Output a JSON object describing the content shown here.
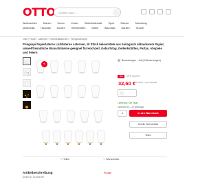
{
  "header": {
    "logo": "OTTO",
    "search_placeholder": "Suchen nach ..."
  },
  "nav": {
    "row1": [
      "Weihnachten",
      "Damen",
      "Herren",
      "Kinder",
      "Weiterbildersale",
      "Sport",
      "Schuhe",
      "Sammlung"
    ],
    "row2": [
      "Multimedia",
      "Haushalt",
      "Küchen",
      "Heimtextilien",
      "Möbel",
      "Baumarkt",
      "Marken",
      "SCAVE"
    ]
  },
  "breadcrumb": "Otto  ›  Feste  ›  Laternen  ›  Himmelslaternen  ›  Ferngesteuerte",
  "product": {
    "title": "Pringsapi Papierlaterne Lichtlaterne Laternen, 10 Stück beleuchtete aus biologisch abbaubarem Papier, umweltfreundliche Wunschlaterne geeignet für Hochzeit, Geburtstag, Gedenkstätten, Partys, Abspiele und Feiern",
    "sale_badge": "%",
    "rating_text": "Bewertungen · 4,8 (6 Bewertungen)",
    "discount_badge": "-5%",
    "old_price": "UVP 34,49 €",
    "price": "32,60 €",
    "price_note": "inkl. MwSt., zzgl. Versand",
    "delivery": "Lieferung: Die Tage",
    "delivery_sub": "Lieferzeit 10 - 20 Werktage",
    "quantity": "1",
    "cart_button": "In den Warenkorb",
    "wishlist_button": "Auf die Wunschliste",
    "share_button": "Teilen"
  },
  "gallery_actions": {
    "share": "Teilen",
    "wishlist": "Wunschliste"
  },
  "section": {
    "title": "Artikelbeschreibung",
    "subtitle": "Artikel-Nr. 123456789",
    "link": "Produkt"
  }
}
